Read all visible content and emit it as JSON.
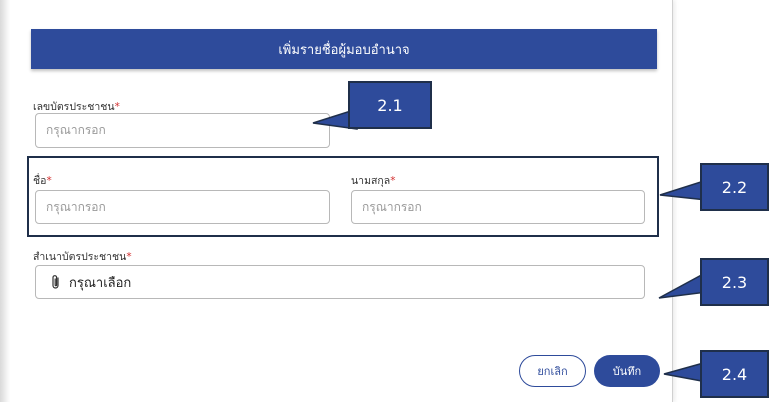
{
  "dialog": {
    "title": "เพิ่มรายชื่อผู้มอบอำนาจ",
    "id_card": {
      "label": "เลขบัตรประชาชน",
      "required_mark": "*",
      "placeholder": "กรุณากรอก"
    },
    "first_name": {
      "label": "ชื่อ",
      "required_mark": "*",
      "placeholder": "กรุณากรอก"
    },
    "last_name": {
      "label": "นามสกุล",
      "required_mark": "*",
      "placeholder": "กรุณากรอก"
    },
    "id_copy": {
      "label": "สำเนาบัตรประชาชน",
      "required_mark": "*",
      "placeholder": "กรุณาเลือก",
      "icon": "paperclip-icon"
    },
    "cancel_label": "ยกเลิก",
    "save_label": "บันทึก"
  },
  "callouts": [
    "2.1",
    "2.2",
    "2.3",
    "2.4"
  ],
  "colors": {
    "primary": "#2e4b9b",
    "required": "#d32f2f",
    "outline": "#1f2f4a"
  }
}
